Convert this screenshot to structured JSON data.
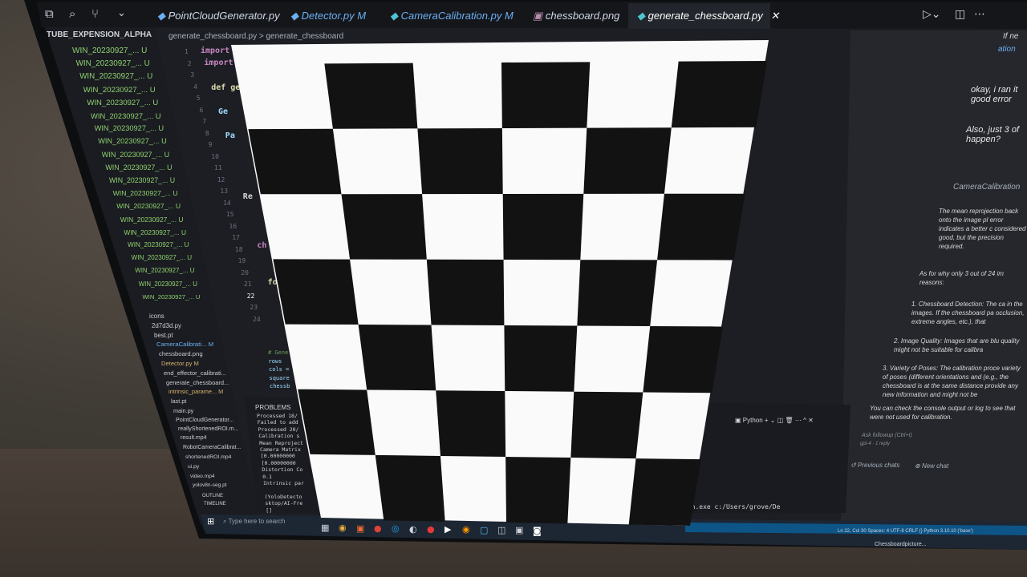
{
  "editor": {
    "tabs": [
      {
        "label": "PointCloudGenerator.py",
        "color": "#cfd8e8"
      },
      {
        "label": "Detector.py M",
        "color": "#6ab0f3"
      },
      {
        "label": "CameraCalibration.py M",
        "color": "#6ab0f3"
      },
      {
        "label": "chessboard.png",
        "color": "#cfd8e8"
      },
      {
        "label": "generate_chessboard.py",
        "color": "#ffffff"
      }
    ],
    "breadcrumb": "generate_chessboard.py > generate_chessboard",
    "explorer_title": "TUBE_EXPENSION_ALPHA",
    "explorer_items": [
      "WIN_20230927_... U",
      "WIN_20230927_... U",
      "WIN_20230927_... U",
      "WIN_20230927_... U",
      "WIN_20230927_... U",
      "WIN_20230927_... U",
      "WIN_20230927_... U",
      "WIN_20230927_... U",
      "WIN_20230927_... U",
      "WIN_20230927_... U",
      "WIN_20230927_... U",
      "WIN_20230927_... U",
      "WIN_20230927_... U",
      "WIN_20230927_... U",
      "WIN_20230927_... U",
      "WIN_20230927_... U",
      "WIN_20230927_... U",
      "WIN_20230927_... U",
      "WIN_20230927_... U",
      "WIN_20230927_... U"
    ],
    "explorer_files": [
      "icons",
      "2d7d3d.py",
      "best.pt",
      "CameraCalibrati... M",
      "chessboard.png",
      "Detector.py M",
      "end_effector_calibrati...",
      "generate_chessboard...",
      "intrinsic_parame... M",
      "last.pt",
      "main.py",
      "PointCloudGenerator...",
      "reallyShortenedROI.m...",
      "result.mp4",
      "RobotCameraCalibrat...",
      "shortenedROI.mp4",
      "ui.py",
      "video.mp4",
      "yolov8n-seg.pt"
    ],
    "line_numbers": [
      "1",
      "2",
      "3",
      "4",
      "5",
      "6",
      "7",
      "8",
      "9",
      "10",
      "11",
      "12",
      "13",
      "14",
      "15",
      "16",
      "17",
      "18",
      "19",
      "20",
      "21",
      "22",
      "23",
      "24"
    ],
    "code_lines": [
      "import",
      "import",
      "",
      "def ge",
      "",
      "Ge",
      "",
      "Pa",
      "",
      "",
      "",
      "",
      "Re",
      "",
      "",
      "",
      "ch",
      "",
      "",
      "fo"
    ],
    "code_extra": [
      "# Gene",
      "rows",
      "cols =",
      "square",
      "chessb"
    ],
    "terminal_header": "PROBLEMS",
    "terminal_lines": [
      "Processed 18/",
      "Failed to add",
      "Processed 20/",
      "Calibration s",
      "Mean Reproject",
      "Camera Matrix",
      "[0.00000000",
      "[0.00000000",
      "Distortion Co",
      "0.1",
      "Intrinsic par",
      "",
      "(YoloDetecto",
      "sktop/AI-Fre",
      "[]"
    ],
    "terminal_right": "hon.exe c:/Users/grove/De",
    "outline": "OUTLINE",
    "timeline": "TIMELINE",
    "status_right": "Ln 22, Col 30   Spaces: 4   UTF-8   CRLF   {} Python   3.10.10 ('base')"
  },
  "chat": {
    "user_msg_1": "okay, i ran it good error",
    "user_msg_2": "Also, just 3 of happen?",
    "reply_ref": "CameraCalibration",
    "reply_p1": "The mean reprojection back onto the image pl error indicates a better c considered good, but the precision required.",
    "reply_p2": "As for why only 3 out of 24 im reasons:",
    "reply_b1": "1. Chessboard Detection: The ca in the images. If the chessboard pa occlusion, extreme angles, etc.), that",
    "reply_b2": "2. Image Quality: Images that are blu quality might not be suitable for calibra",
    "reply_b3": "3. Variety of Poses: The calibration proce variety of poses (different orientations and (e.g., the chessboard is at the same distance provide any new information and might not be",
    "reply_p3": "You can check the console output or log to see that were not used for calibration.",
    "followup": "Ask followup (Ctrl+I)",
    "model": "gpt-4 · 1 reply",
    "prev_chats": "Previous chats",
    "new_chat": "New chat",
    "top_right": "If ne",
    "top_right2": "ation"
  },
  "taskbar": {
    "search_placeholder": "Type here to search",
    "tray_text": "Chessboardpicture..."
  },
  "panel_label": "Python",
  "colors": {
    "editor_bg": "#1c1e24",
    "sidebar_bg": "#1a1c21",
    "tab_bar_bg": "#15161a",
    "active_tab_bg": "#22252c",
    "chat_bg": "#25272c",
    "taskbar_bg": "#1d2633",
    "explorer_green": "#8fd06f",
    "accent_blue": "#3a8ee6",
    "chessboard_black": "#121212",
    "chessboard_white": "#fafafa"
  }
}
